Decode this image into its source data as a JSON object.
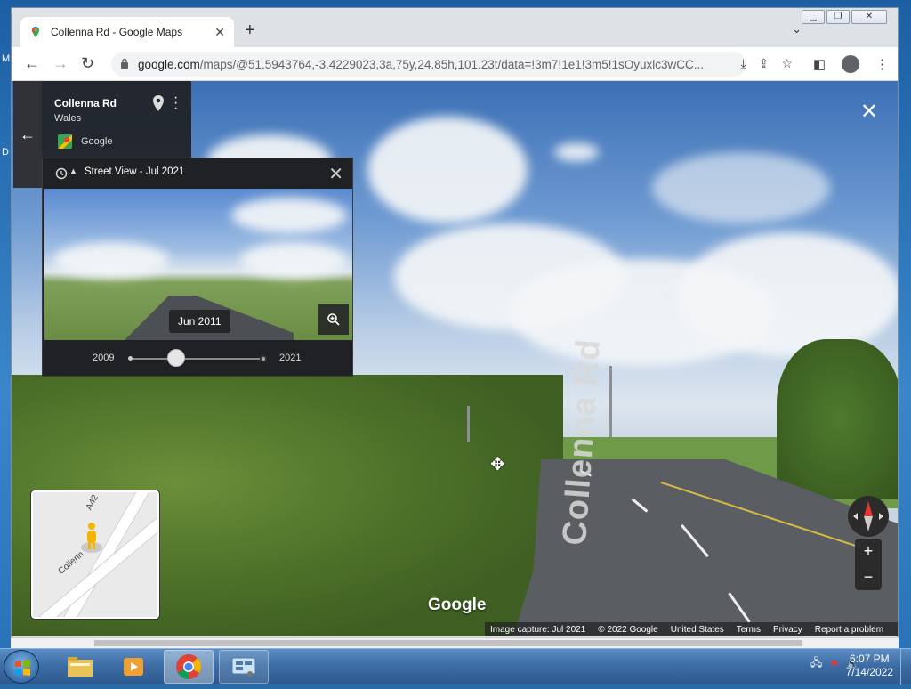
{
  "browser": {
    "tab_title": "Collenna Rd - Google Maps",
    "new_tab_symbol": "+",
    "url_host": "google.com",
    "url_path": "/maps/@51.5943764,-3.4229023,3a,75y,24.85h,101.23t/data=!3m7!1e1!3m5!1sOyuxlc3wCC...",
    "window_controls": [
      "minimize",
      "maximize",
      "close"
    ]
  },
  "place_card": {
    "title": "Collenna Rd",
    "subtitle": "Wales",
    "source": "Google",
    "icons": [
      "back-arrow-icon",
      "pin-icon",
      "more-vert-icon",
      "google-maps-icon"
    ]
  },
  "timeline": {
    "title": "Street View - Jul 2021",
    "hover_date": "Jun 2011",
    "start_year": "2009",
    "end_year": "2021",
    "selected_position_fraction": 0.33
  },
  "streetview": {
    "road_label": "Collenna Rd",
    "logo": "Google",
    "minimap_labels": [
      "A42",
      "Collenn"
    ],
    "footer": [
      "Image capture: Jul 2021",
      "© 2022 Google",
      "United States",
      "Terms",
      "Privacy",
      "Report a problem"
    ],
    "zoom_in": "+",
    "zoom_out": "−"
  },
  "desktop": {
    "left_letters": [
      "M",
      "D"
    ]
  },
  "taskbar": {
    "time": "6:07 PM",
    "date": "7/14/2022",
    "apps": [
      "file-explorer",
      "media-player",
      "chrome",
      "control-panel"
    ]
  }
}
